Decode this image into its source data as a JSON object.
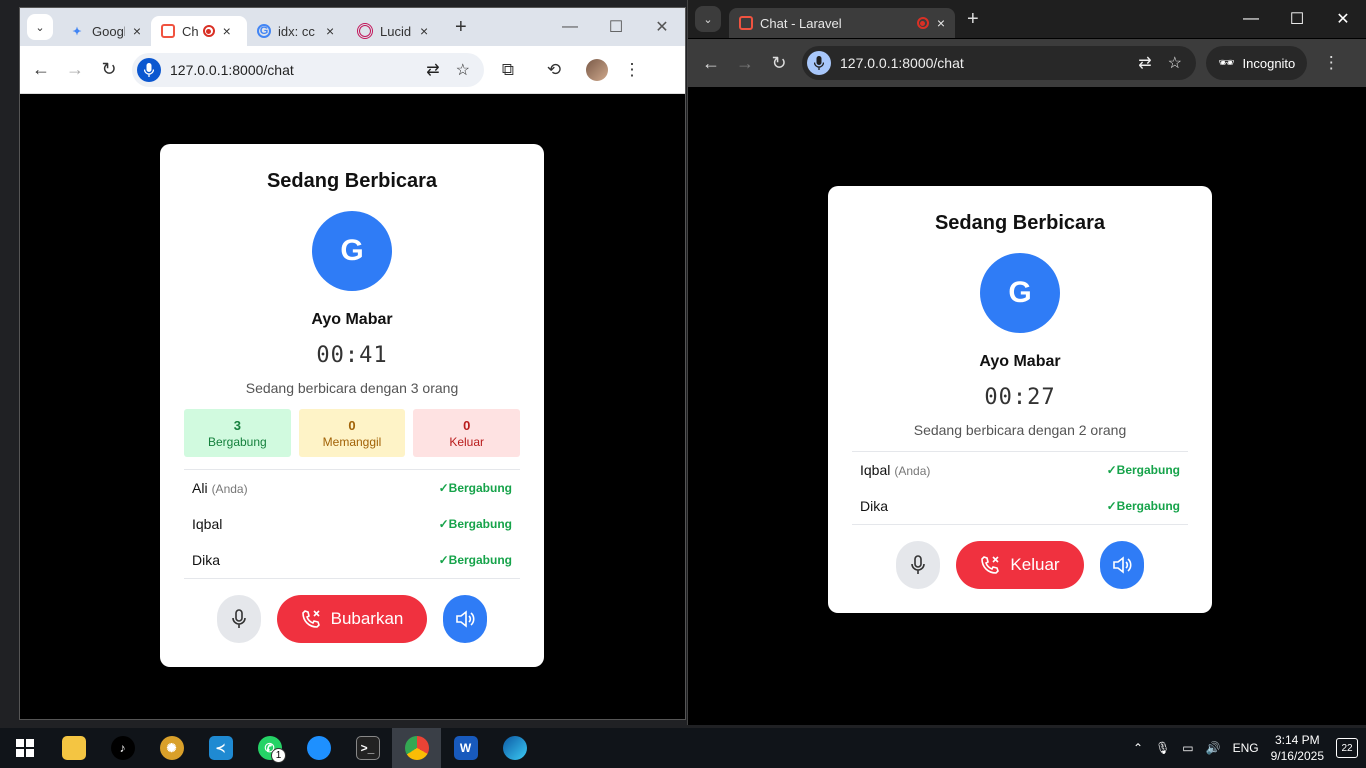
{
  "left_window": {
    "tabs": [
      {
        "label": "Googl",
        "icon": "gemini-icon"
      },
      {
        "label": "Ch",
        "icon": "laravel-icon",
        "recording": true,
        "active": true
      },
      {
        "label": "idx: cc",
        "icon": "google-icon"
      },
      {
        "label": "Lucid",
        "icon": "lucid-icon"
      }
    ],
    "url": "127.0.0.1:8000/chat",
    "call": {
      "title": "Sedang Berbicara",
      "avatar_letter": "G",
      "room": "Ayo Mabar",
      "timer": "00:41",
      "subtitle": "Sedang berbicara dengan 3 orang",
      "stats": [
        {
          "value": "3",
          "label": "Bergabung"
        },
        {
          "value": "0",
          "label": "Memanggil"
        },
        {
          "value": "0",
          "label": "Keluar"
        }
      ],
      "participants": [
        {
          "name": "Ali",
          "you": "(Anda)",
          "status": "✓Bergabung"
        },
        {
          "name": "Iqbal",
          "you": "",
          "status": "✓Bergabung"
        },
        {
          "name": "Dika",
          "you": "",
          "status": "✓Bergabung"
        }
      ],
      "end_label": "Bubarkan"
    }
  },
  "right_window": {
    "tab_label": "Chat - Laravel",
    "url": "127.0.0.1:8000/chat",
    "incognito_label": "Incognito",
    "call": {
      "title": "Sedang Berbicara",
      "avatar_letter": "G",
      "room": "Ayo Mabar",
      "timer": "00:27",
      "subtitle": "Sedang berbicara dengan 2 orang",
      "participants": [
        {
          "name": "Iqbal",
          "you": "(Anda)",
          "status": "✓Bergabung"
        },
        {
          "name": "Dika",
          "you": "",
          "status": "✓Bergabung"
        }
      ],
      "end_label": "Keluar"
    }
  },
  "taskbar": {
    "whatsapp_badge": "1",
    "lang": "ENG",
    "time": "3:14 PM",
    "date": "9/16/2025",
    "notifications": "22"
  },
  "colors": {
    "accent_blue": "#2f7cf6",
    "end_red": "#f0313f",
    "joined_green": "#16a34a"
  }
}
